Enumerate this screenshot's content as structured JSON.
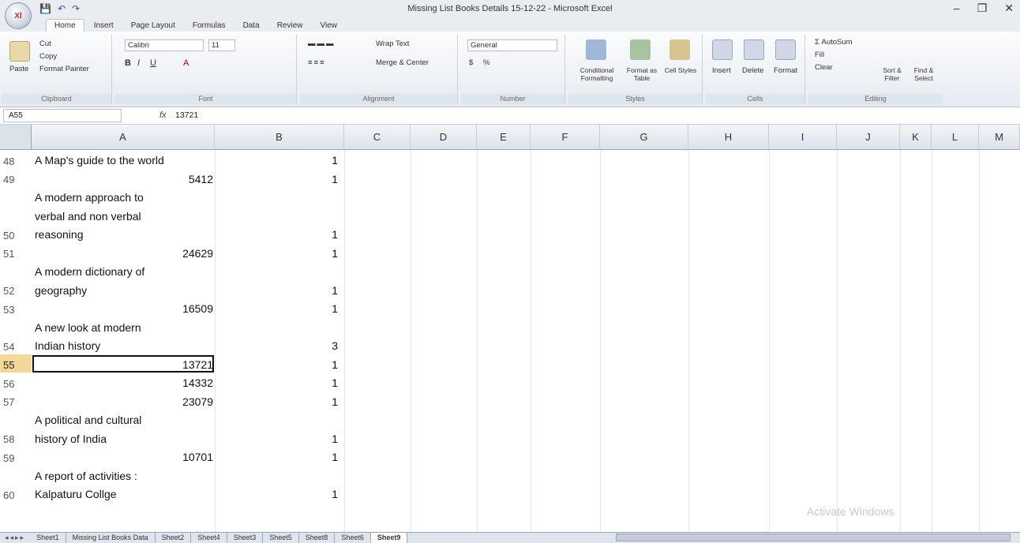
{
  "window": {
    "office_button": "Xl",
    "title": "Missing List Books Details 15-12-22 - Microsoft Excel",
    "minimize": "–",
    "restore": "❐",
    "close": "✕"
  },
  "qat": {
    "save": "💾",
    "undo": "↶",
    "redo": "↷"
  },
  "tabs": [
    "Home",
    "Insert",
    "Page Layout",
    "Formulas",
    "Data",
    "Review",
    "View"
  ],
  "ribbon": {
    "clipboard": {
      "paste": "Paste",
      "cut": "Cut",
      "copy": "Copy",
      "format_painter": "Format Painter",
      "label": "Clipboard"
    },
    "font": {
      "name": "Calibri",
      "size": "11",
      "label": "Font"
    },
    "alignment": {
      "wrap": "Wrap Text",
      "merge": "Merge & Center",
      "label": "Alignment"
    },
    "number": {
      "format": "General",
      "currency": "$",
      "percent": "%",
      "label": "Number"
    },
    "styles": {
      "conditional": "Conditional Formatting",
      "format_table": "Format as Table",
      "cell_styles": "Cell Styles",
      "label": "Styles"
    },
    "cells": {
      "insert": "Insert",
      "delete": "Delete",
      "format": "Format",
      "label": "Cells"
    },
    "editing": {
      "autosum": "AutoSum",
      "fill": "Fill",
      "clear": "Clear",
      "sort": "Sort & Filter",
      "find": "Find & Select",
      "label": "Editing"
    }
  },
  "formula_bar": {
    "name_box": "A55",
    "fx": "fx",
    "value": "13721"
  },
  "columns": [
    "A",
    "B",
    "C",
    "D",
    "E",
    "F",
    "G",
    "H",
    "I",
    "J",
    "K",
    "L",
    "M"
  ],
  "rows": [
    {
      "num": "48",
      "a_lines": [
        "A Map's guide to the world"
      ],
      "a_num": "",
      "b": "1"
    },
    {
      "num": "49",
      "a_lines": [],
      "a_num": "5412",
      "b": "1"
    },
    {
      "num": "50",
      "a_lines": [
        "A modern approach to",
        "verbal and non verbal",
        "reasoning"
      ],
      "a_num": "",
      "b": "1"
    },
    {
      "num": "51",
      "a_lines": [],
      "a_num": "24629",
      "b": "1"
    },
    {
      "num": "52",
      "a_lines": [
        "A modern dictionary of",
        "geography"
      ],
      "a_num": "",
      "b": "1"
    },
    {
      "num": "53",
      "a_lines": [],
      "a_num": "16509",
      "b": "1"
    },
    {
      "num": "54",
      "a_lines": [
        "A new look at modern",
        "Indian history"
      ],
      "a_num": "",
      "b": "3"
    },
    {
      "num": "55",
      "a_lines": [],
      "a_num": "13721",
      "b": "1",
      "selected": true
    },
    {
      "num": "56",
      "a_lines": [],
      "a_num": "14332",
      "b": "1"
    },
    {
      "num": "57",
      "a_lines": [],
      "a_num": "23079",
      "b": "1"
    },
    {
      "num": "58",
      "a_lines": [
        "A political and cultural",
        "history of India"
      ],
      "a_num": "",
      "b": "1"
    },
    {
      "num": "59",
      "a_lines": [],
      "a_num": "10701",
      "b": "1"
    },
    {
      "num": "60",
      "a_lines": [
        "A report of activities :",
        "Kalpaturu Collge"
      ],
      "a_num": "",
      "b": "1"
    }
  ],
  "sheet_tabs": [
    "Sheet1",
    "Missing List Books Data",
    "Sheet2",
    "Sheet4",
    "Sheet3",
    "Sheet5",
    "Sheet8",
    "Sheet6",
    "Sheet9"
  ],
  "active_sheet": "Sheet9",
  "watermark": "Activate Windows"
}
